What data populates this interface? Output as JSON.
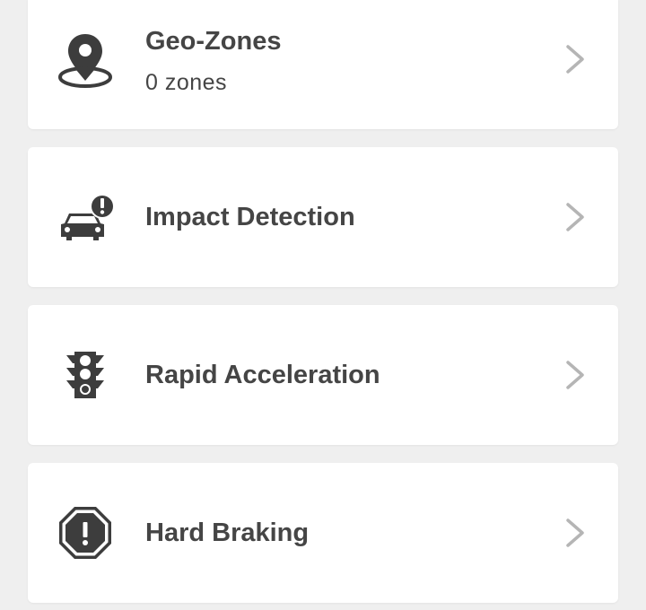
{
  "items": [
    {
      "id": "geo-zones",
      "title": "Geo-Zones",
      "subtitle": "0 zones",
      "icon": "map-pin-icon"
    },
    {
      "id": "impact-detection",
      "title": "Impact Detection",
      "icon": "car-alert-icon"
    },
    {
      "id": "rapid-acceleration",
      "title": "Rapid Acceleration",
      "icon": "traffic-light-icon"
    },
    {
      "id": "hard-braking",
      "title": "Hard Braking",
      "icon": "octagon-alert-icon"
    }
  ],
  "colors": {
    "background": "#efefef",
    "card": "#ffffff",
    "text": "#454545",
    "icon": "#3d3d3d",
    "chevron": "#b5b5b5"
  }
}
